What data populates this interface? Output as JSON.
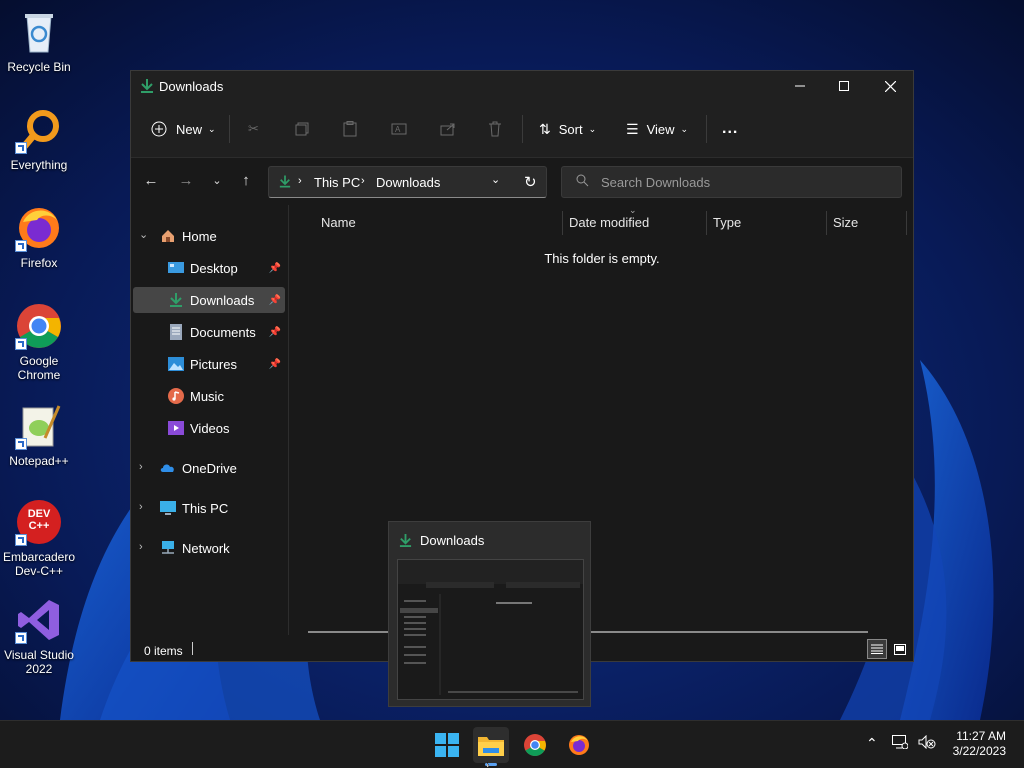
{
  "desktop": {
    "icons": [
      {
        "label": "Recycle Bin",
        "icon": "recycle-bin-icon"
      },
      {
        "label": "Everything",
        "icon": "everything-search-icon"
      },
      {
        "label": "Firefox",
        "icon": "firefox-icon"
      },
      {
        "label": "Google Chrome",
        "icon": "chrome-icon"
      },
      {
        "label": "Notepad++",
        "icon": "notepadpp-icon"
      },
      {
        "label": "Embarcadero Dev-C++",
        "icon": "devcpp-icon",
        "badge": "DEV C++"
      },
      {
        "label": "Visual Studio 2022",
        "icon": "visual-studio-icon"
      }
    ]
  },
  "window": {
    "title": "Downloads",
    "toolbar": {
      "new_label": "New",
      "sort_label": "Sort",
      "view_label": "View",
      "more_label": "..."
    },
    "address": {
      "crumbs": [
        "This PC",
        "Downloads"
      ]
    },
    "search": {
      "placeholder": "Search Downloads"
    },
    "sidebar": {
      "items": [
        {
          "label": "Home",
          "icon": "home-icon",
          "expand": true,
          "expanded": true
        },
        {
          "label": "Desktop",
          "icon": "desktop-folder-icon",
          "pinned": true
        },
        {
          "label": "Downloads",
          "icon": "download-icon",
          "pinned": true,
          "selected": true
        },
        {
          "label": "Documents",
          "icon": "documents-icon",
          "pinned": true
        },
        {
          "label": "Pictures",
          "icon": "pictures-icon",
          "pinned": true
        },
        {
          "label": "Music",
          "icon": "music-icon"
        },
        {
          "label": "Videos",
          "icon": "videos-icon"
        },
        {
          "label": "OneDrive",
          "icon": "onedrive-icon",
          "expand": true
        },
        {
          "label": "This PC",
          "icon": "this-pc-icon",
          "expand": true
        },
        {
          "label": "Network",
          "icon": "network-icon",
          "expand": true
        }
      ]
    },
    "columns": [
      "Name",
      "Date modified",
      "Type",
      "Size"
    ],
    "empty_message": "This folder is empty.",
    "status": {
      "items_count": "0 items"
    }
  },
  "thumbnail": {
    "title": "Downloads"
  },
  "taskbar": {
    "apps": [
      "windows-start-icon",
      "file-explorer-icon",
      "chrome-icon",
      "firefox-icon"
    ],
    "clock": {
      "time": "11:27 AM",
      "date": "3/22/2023"
    }
  },
  "colors": {
    "accent": "#2f9e68",
    "selection": "#464646",
    "background": "#191919"
  }
}
